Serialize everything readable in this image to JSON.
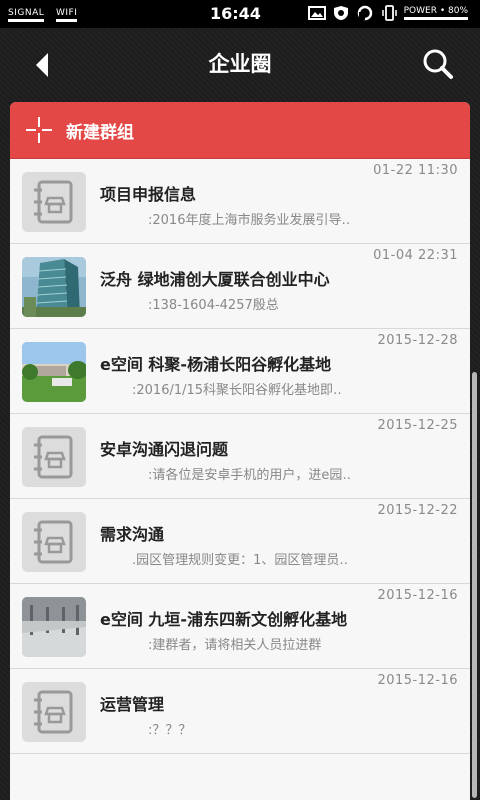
{
  "status": {
    "signal": "SIGNAL",
    "wifi": "WIFI",
    "time": "16:44",
    "power": "POWER • 80%"
  },
  "header": {
    "title": "企业圈"
  },
  "new_group": {
    "label": "新建群组"
  },
  "groups": [
    {
      "date": "01-22  11:30",
      "name": "项目申报信息",
      "message": ":2016年度上海市服务业发展引导‥",
      "thumb": "notebook-icon"
    },
    {
      "date": "01-04  22:31",
      "name": "泛舟  绿地浦创大厦联合创业中心",
      "message": ":138-1604-4257殷总",
      "thumb": "building-photo"
    },
    {
      "date": "2015-12-28",
      "name": "e空间  科聚-杨浦长阳谷孵化基地",
      "message": ":2016/1/15科聚长阳谷孵化基地即‥",
      "thumb": "campus-photo"
    },
    {
      "date": "2015-12-25",
      "name": "安卓沟通闪退问题",
      "message": ":请各位是安卓手机的用户，进e园‥",
      "thumb": "notebook-icon"
    },
    {
      "date": "2015-12-22",
      "name": "需求沟通",
      "message": ".园区管理规则变更：1、园区管理员‥",
      "thumb": "notebook-icon"
    },
    {
      "date": "2015-12-16",
      "name": "e空间  九垣-浦东四新文创孵化基地",
      "message": ":建群者，请将相关人员拉进群",
      "thumb": "hall-photo"
    },
    {
      "date": "2015-12-16",
      "name": "运营管理",
      "message": ":？？？",
      "thumb": "notebook-icon"
    }
  ]
}
